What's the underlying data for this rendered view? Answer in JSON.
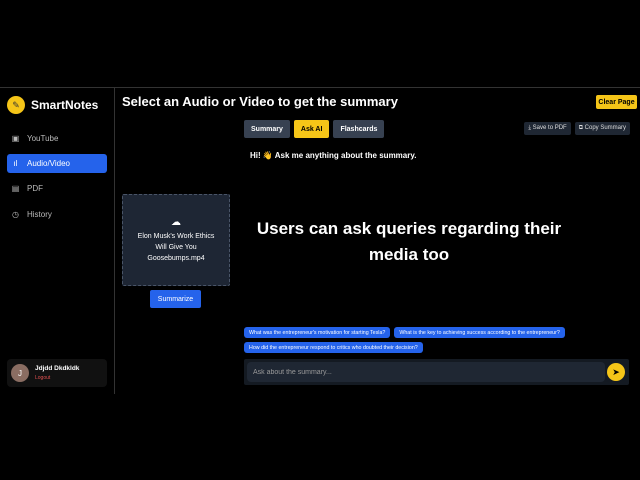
{
  "sidebar": {
    "brand": "SmartNotes",
    "items": [
      {
        "label": "YouTube",
        "icon": "youtube-icon"
      },
      {
        "label": "Audio/Video",
        "icon": "audio-wave-icon"
      },
      {
        "label": "PDF",
        "icon": "document-icon"
      },
      {
        "label": "History",
        "icon": "clock-icon"
      }
    ],
    "user": {
      "initial": "J",
      "name": "Jdjdd Dkdkldk",
      "logout": "Logout"
    }
  },
  "header": {
    "title": "Select an Audio or Video to get the summary",
    "clear": "Clear Page"
  },
  "upload": {
    "filename": "Elon Musk's Work Ethics Will Give You Goosebumps.mp4",
    "button": "Summarize"
  },
  "tabs": [
    "Summary",
    "Ask AI",
    "Flashcards"
  ],
  "tools": {
    "save": "⤓ Save to PDF",
    "copy": "⧉ Copy Summary"
  },
  "chat": {
    "greeting": "Hi! 👋 Ask me anything about the summary.",
    "suggestions": [
      "What was the entrepreneur's motivation for starting Tesla?",
      "What is the key to achieving success according to the entrepreneur?",
      "How did the entrepreneur respond to critics who doubted their decision?"
    ],
    "placeholder": "Ask about the summary..."
  },
  "overlay": "Users can ask queries regarding their media too",
  "colors": {
    "accent": "#2563eb",
    "yellow": "#f5c518"
  }
}
